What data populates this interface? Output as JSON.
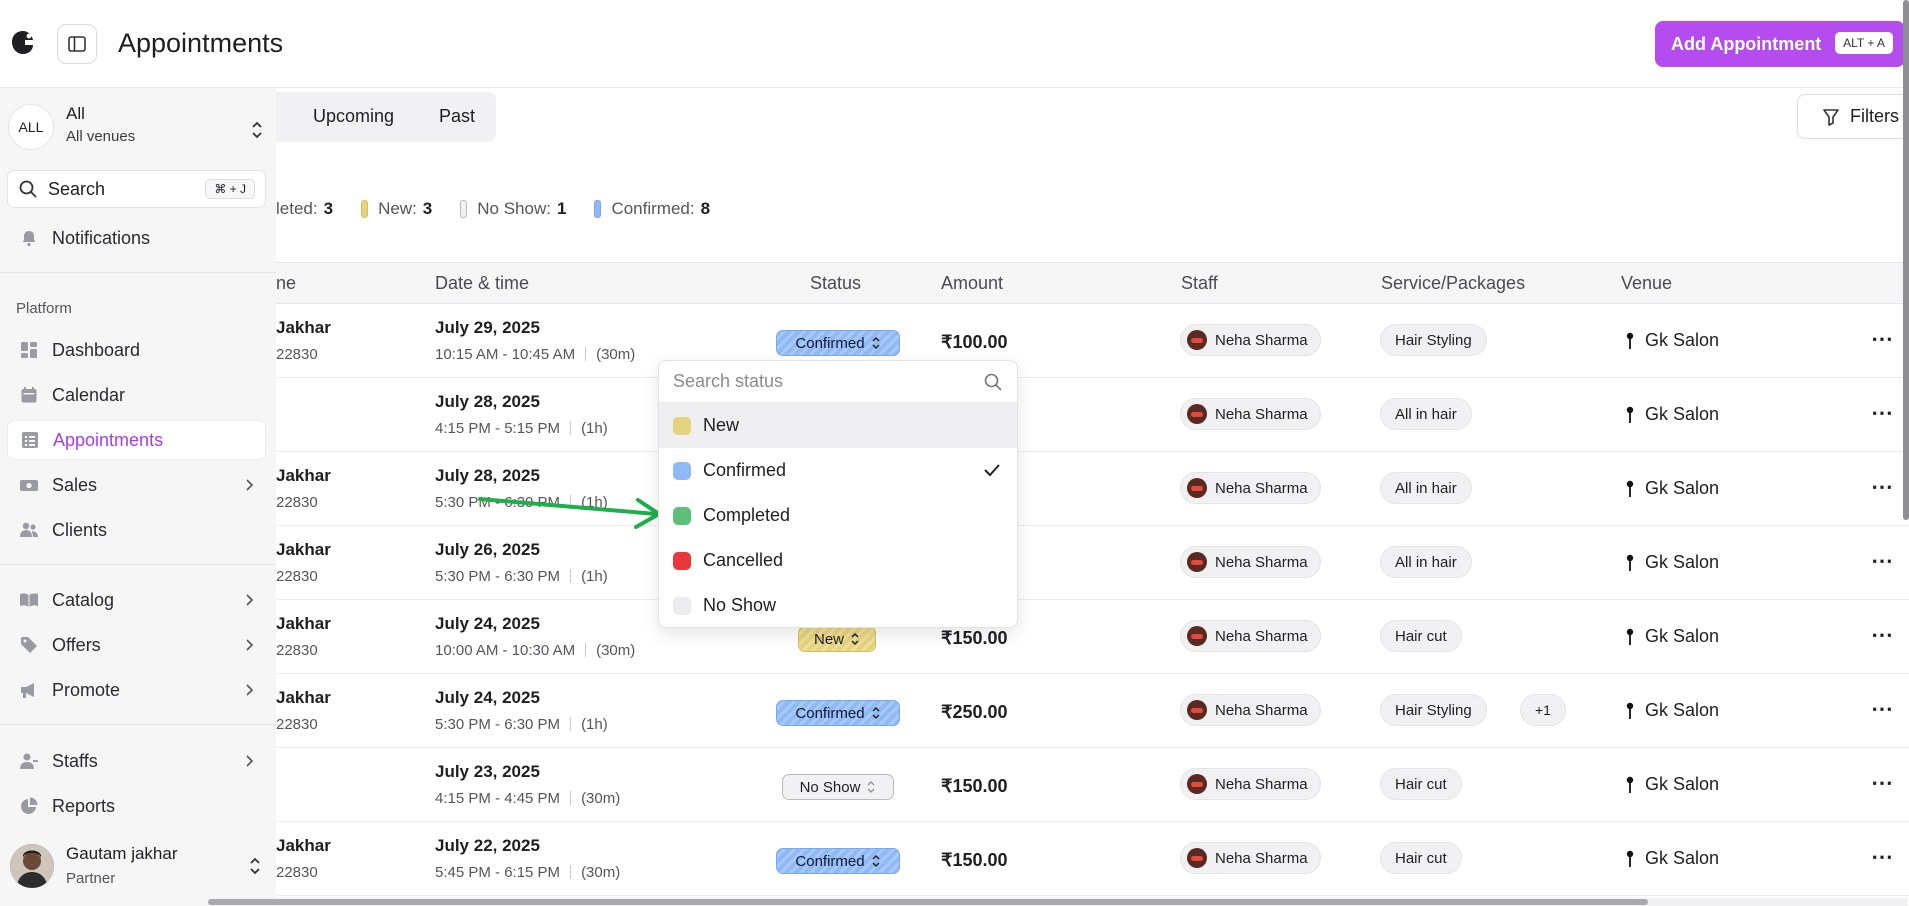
{
  "header": {
    "title": "Appointments",
    "add_button": "Add Appointment",
    "add_shortcut": "ALT + A"
  },
  "sidebar": {
    "venue": {
      "avatar": "ALL",
      "title": "All",
      "subtitle": "All venues"
    },
    "search": {
      "label": "Search",
      "shortcut": "⌘ + J"
    },
    "notifications": "Notifications",
    "section_label": "Platform",
    "items": [
      {
        "label": "Dashboard",
        "icon": "dashboard-icon"
      },
      {
        "label": "Calendar",
        "icon": "calendar-icon"
      },
      {
        "label": "Appointments",
        "icon": "list-icon",
        "active": true
      },
      {
        "label": "Sales",
        "icon": "money-icon",
        "chevron": true
      },
      {
        "label": "Clients",
        "icon": "users-icon"
      },
      {
        "label": "Catalog",
        "icon": "book-icon",
        "chevron": true
      },
      {
        "label": "Offers",
        "icon": "tag-icon",
        "chevron": true
      },
      {
        "label": "Promote",
        "icon": "megaphone-icon",
        "chevron": true
      },
      {
        "label": "Staffs",
        "icon": "staff-icon",
        "chevron": true
      },
      {
        "label": "Reports",
        "icon": "pie-chart-icon"
      }
    ],
    "user": {
      "name": "Gautam jakhar",
      "role": "Partner"
    }
  },
  "tabs": {
    "upcoming": "Upcoming",
    "past": "Past"
  },
  "filters_label": "Filters",
  "summary": [
    {
      "label": "leted:",
      "count": "3",
      "color": "#ffffff"
    },
    {
      "label": "New:",
      "count": "3",
      "color": "#e7d37d"
    },
    {
      "label": "No Show:",
      "count": "1",
      "color": "#f1f1f3"
    },
    {
      "label": "Confirmed:",
      "count": "8",
      "color": "#8fb9f7"
    }
  ],
  "table": {
    "headers": {
      "name": "ne",
      "date": "Date & time",
      "status": "Status",
      "amount": "Amount",
      "staff": "Staff",
      "service": "Service/Packages",
      "venue": "Venue"
    },
    "rows": [
      {
        "name": "Jakhar",
        "phone": "22830",
        "date": "July 29, 2025",
        "time": "10:15 AM - 10:45 AM",
        "duration": "(30m)",
        "status": "Confirmed",
        "amount": "₹100.00",
        "staff": "Neha Sharma",
        "service": "Hair Styling",
        "extra": "",
        "venue": "Gk Salon"
      },
      {
        "name": "",
        "phone": "",
        "date": "July 28, 2025",
        "time": "4:15 PM - 5:15 PM",
        "duration": "(1h)",
        "status": "",
        "amount": "",
        "staff": "Neha Sharma",
        "service": "All in hair",
        "extra": "",
        "venue": "Gk Salon"
      },
      {
        "name": "Jakhar",
        "phone": "22830",
        "date": "July 28, 2025",
        "time": "5:30 PM - 6:30 PM",
        "duration": "(1h)",
        "status": "",
        "amount": "",
        "staff": "Neha Sharma",
        "service": "All in hair",
        "extra": "",
        "venue": "Gk Salon"
      },
      {
        "name": "Jakhar",
        "phone": "22830",
        "date": "July 26, 2025",
        "time": "5:30 PM - 6:30 PM",
        "duration": "(1h)",
        "status": "",
        "amount": "",
        "staff": "Neha Sharma",
        "service": "All in hair",
        "extra": "",
        "venue": "Gk Salon"
      },
      {
        "name": "Jakhar",
        "phone": "22830",
        "date": "July 24, 2025",
        "time": "10:00 AM - 10:30 AM",
        "duration": "(30m)",
        "status": "New",
        "amount": "₹150.00",
        "staff": "Neha Sharma",
        "service": "Hair cut",
        "extra": "",
        "venue": "Gk Salon"
      },
      {
        "name": "Jakhar",
        "phone": "22830",
        "date": "July 24, 2025",
        "time": "5:30 PM - 6:30 PM",
        "duration": "(1h)",
        "status": "Confirmed",
        "amount": "₹250.00",
        "staff": "Neha Sharma",
        "service": "Hair Styling",
        "extra": "+1",
        "venue": "Gk Salon"
      },
      {
        "name": "",
        "phone": "",
        "date": "July 23, 2025",
        "time": "4:15 PM - 4:45 PM",
        "duration": "(30m)",
        "status": "No Show",
        "amount": "₹150.00",
        "staff": "Neha Sharma",
        "service": "Hair cut",
        "extra": "",
        "venue": "Gk Salon"
      },
      {
        "name": "Jakhar",
        "phone": "22830",
        "date": "July 22, 2025",
        "time": "5:45 PM - 6:15 PM",
        "duration": "(30m)",
        "status": "Confirmed",
        "amount": "₹150.00",
        "staff": "Neha Sharma",
        "service": "Hair cut",
        "extra": "",
        "venue": "Gk Salon"
      }
    ]
  },
  "status_dropdown": {
    "placeholder": "Search status",
    "options": [
      {
        "label": "New",
        "color": "#e3d27f",
        "highlighted": true
      },
      {
        "label": "Confirmed",
        "color": "#8fb9f7",
        "selected": true
      },
      {
        "label": "Completed",
        "color": "#5fbf7a"
      },
      {
        "label": "Cancelled",
        "color": "#e8383b"
      },
      {
        "label": "No Show",
        "color": "#ececef"
      }
    ]
  },
  "colors": {
    "accent": "#b44cf0",
    "arrow": "#1fae4a"
  }
}
